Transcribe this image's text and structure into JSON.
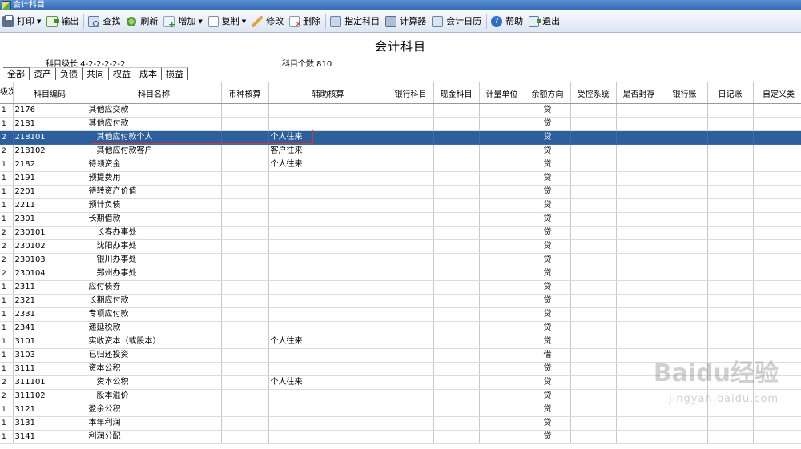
{
  "window": {
    "title": "会计科目"
  },
  "toolbar": {
    "items": [
      {
        "label": "打印",
        "icon": "print-icon",
        "dropdown": true
      },
      {
        "label": "输出",
        "icon": "export-icon"
      },
      {
        "label": "查找",
        "icon": "find-icon"
      },
      {
        "label": "刷新",
        "icon": "refresh-icon"
      },
      {
        "label": "增加",
        "icon": "add-icon",
        "dropdown": true
      },
      {
        "label": "复制",
        "icon": "copy-icon",
        "dropdown": true
      },
      {
        "label": "修改",
        "icon": "edit-icon"
      },
      {
        "label": "删除",
        "icon": "delete-icon"
      },
      {
        "label": "指定科目",
        "icon": "assign-icon"
      },
      {
        "label": "计算器",
        "icon": "calculator-icon"
      },
      {
        "label": "会计日历",
        "icon": "calendar-icon"
      },
      {
        "label": "帮助",
        "icon": "help-icon"
      },
      {
        "label": "退出",
        "icon": "exit-icon"
      }
    ]
  },
  "page": {
    "title": "会计科目",
    "level_info": "科目级长  4-2-2-2-2-2",
    "count_info": "科目个数  810"
  },
  "tabs": [
    {
      "label": "全部",
      "active": true
    },
    {
      "label": "资产"
    },
    {
      "label": "负债"
    },
    {
      "label": "共同"
    },
    {
      "label": "权益"
    },
    {
      "label": "成本"
    },
    {
      "label": "损益"
    }
  ],
  "table": {
    "headers": [
      "级次",
      "科目编码",
      "科目名称",
      "币种核算",
      "辅助核算",
      "银行科目",
      "现金科目",
      "计量单位",
      "余额方向",
      "受控系统",
      "是否封存",
      "银行账",
      "日记账",
      "自定义类"
    ],
    "rows": [
      {
        "level": "1",
        "code": "2176",
        "name": "其他应交款",
        "aux": "",
        "dir": "贷"
      },
      {
        "level": "1",
        "code": "2181",
        "name": "其他应付款",
        "aux": "",
        "dir": "贷"
      },
      {
        "level": "2",
        "code": "218101",
        "name": "其他应付款个人",
        "aux": "个人往来",
        "dir": "贷",
        "selected": true
      },
      {
        "level": "2",
        "code": "218102",
        "name": "其他应付款客户",
        "aux": "客户往来",
        "dir": "贷"
      },
      {
        "level": "1",
        "code": "2182",
        "name": "待领资金",
        "aux": "个人往来",
        "dir": "贷"
      },
      {
        "level": "1",
        "code": "2191",
        "name": "预提费用",
        "aux": "",
        "dir": "贷"
      },
      {
        "level": "1",
        "code": "2201",
        "name": "待转资产价值",
        "aux": "",
        "dir": "贷"
      },
      {
        "level": "1",
        "code": "2211",
        "name": "预计负债",
        "aux": "",
        "dir": "贷"
      },
      {
        "level": "1",
        "code": "2301",
        "name": "长期借款",
        "aux": "",
        "dir": "贷"
      },
      {
        "level": "2",
        "code": "230101",
        "name": "长春办事处",
        "aux": "",
        "dir": "贷"
      },
      {
        "level": "2",
        "code": "230102",
        "name": "沈阳办事处",
        "aux": "",
        "dir": "贷"
      },
      {
        "level": "2",
        "code": "230103",
        "name": "银川办事处",
        "aux": "",
        "dir": "贷"
      },
      {
        "level": "2",
        "code": "230104",
        "name": "郑州办事处",
        "aux": "",
        "dir": "贷"
      },
      {
        "level": "1",
        "code": "2311",
        "name": "应付债券",
        "aux": "",
        "dir": "贷"
      },
      {
        "level": "1",
        "code": "2321",
        "name": "长期应付款",
        "aux": "",
        "dir": "贷"
      },
      {
        "level": "1",
        "code": "2331",
        "name": "专项应付款",
        "aux": "",
        "dir": "贷"
      },
      {
        "level": "1",
        "code": "2341",
        "name": "递延税款",
        "aux": "",
        "dir": "贷"
      },
      {
        "level": "1",
        "code": "3101",
        "name": "实收资本（或股本）",
        "aux": "个人往来",
        "dir": "贷"
      },
      {
        "level": "1",
        "code": "3103",
        "name": "已归还投资",
        "aux": "",
        "dir": "借"
      },
      {
        "level": "1",
        "code": "3111",
        "name": "资本公积",
        "aux": "",
        "dir": "贷"
      },
      {
        "level": "2",
        "code": "311101",
        "name": "资本公积",
        "aux": "个人往来",
        "dir": "贷"
      },
      {
        "level": "2",
        "code": "311102",
        "name": "股本溢价",
        "aux": "",
        "dir": "贷"
      },
      {
        "level": "1",
        "code": "3121",
        "name": "盈余公积",
        "aux": "",
        "dir": "贷"
      },
      {
        "level": "1",
        "code": "3131",
        "name": "本年利润",
        "aux": "",
        "dir": "贷"
      },
      {
        "level": "1",
        "code": "3141",
        "name": "利润分配",
        "aux": "",
        "dir": "贷"
      }
    ]
  },
  "watermark": {
    "line1": "Baidu经验",
    "line2": "jingyan.baidu.com"
  }
}
